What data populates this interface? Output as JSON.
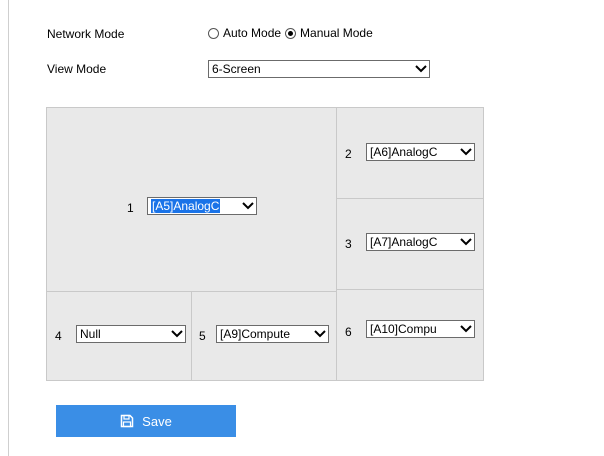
{
  "form": {
    "network_mode_label": "Network Mode",
    "network_modes": [
      "Auto Mode",
      "Manual Mode"
    ],
    "network_mode_selected": "Manual Mode",
    "view_mode_label": "View Mode",
    "view_mode_value": "6-Screen"
  },
  "cells": [
    {
      "num": "1",
      "value": "[A5]AnalogC"
    },
    {
      "num": "2",
      "value": "[A6]AnalogC"
    },
    {
      "num": "3",
      "value": "[A7]AnalogC"
    },
    {
      "num": "4",
      "value": "Null"
    },
    {
      "num": "5",
      "value": "[A9]Compute"
    },
    {
      "num": "6",
      "value": "[A10]Compu"
    }
  ],
  "save_label": "Save",
  "icons": {
    "select_arrow": "chevron-down-icon",
    "save": "save-icon"
  },
  "colors": {
    "save_button": "#3a8ee6",
    "highlight": "#1a73e8",
    "panel": "#e9e9e9"
  }
}
